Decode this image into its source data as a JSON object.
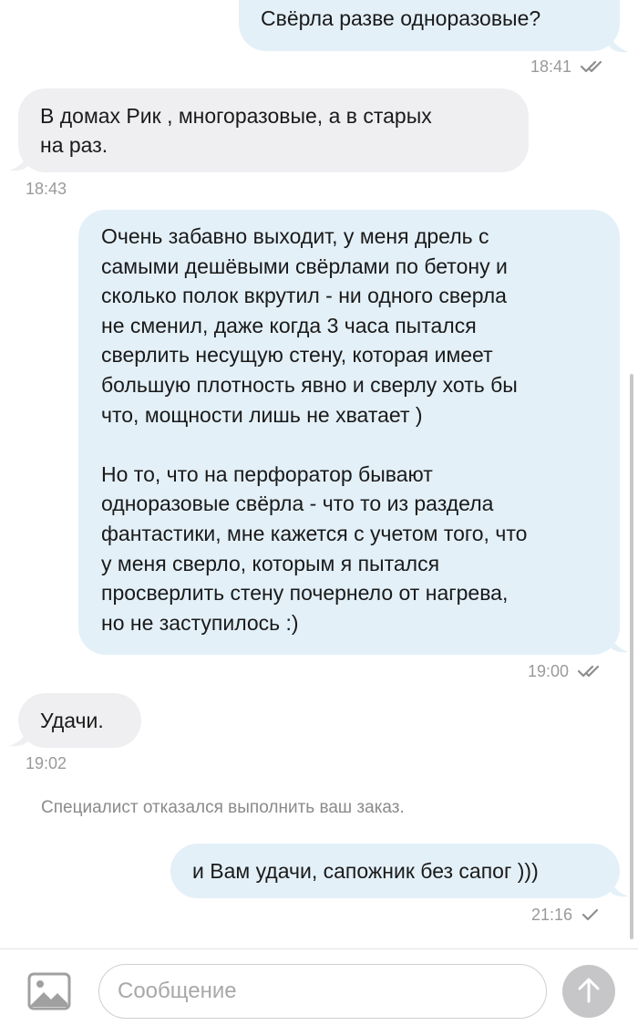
{
  "messages": [
    {
      "direction": "outgoing",
      "text": "Свёрла разве одноразовые?",
      "time": "18:41",
      "status": "read"
    },
    {
      "direction": "incoming",
      "text": "В домах Рик , многоразовые, а в старых\nна раз.",
      "time": "18:43"
    },
    {
      "direction": "outgoing",
      "text": "Очень забавно выходит, у меня дрель с\nсамыми дешёвыми свёрлами по бетону и\nсколько полок вкрутил - ни одного сверла\nне сменил, даже когда 3 часа пытался\nсверлить несущую стену, которая имеет\nбольшую плотность явно и сверлу хоть бы\nчто, мощности лишь не хватает )\n\nНо то, что на перфоратор бывают\nодноразовые свёрла - что то из раздела\nфантастики, мне кажется с учетом того, что\nу меня сверло, которым я пытался\nпросверлить стену почернело от нагрева,\nно не заступилось :)",
      "time": "19:00",
      "status": "read"
    },
    {
      "direction": "incoming",
      "text": "Удачи.",
      "time": "19:02"
    },
    {
      "direction": "outgoing",
      "text": "и Вам удачи, сапожник без сапог )))",
      "time": "21:16",
      "status": "sent"
    }
  ],
  "system_notice": "Специалист отказался выполнить ваш заказ.",
  "composer": {
    "placeholder": "Сообщение",
    "attach_icon": "image-icon",
    "send_icon": "arrow-up-icon"
  },
  "colors": {
    "outgoing_bubble": "#e3f0f8",
    "incoming_bubble": "#efeff1",
    "meta_text": "#9a9a9a",
    "send_button": "#c6c6c8"
  }
}
